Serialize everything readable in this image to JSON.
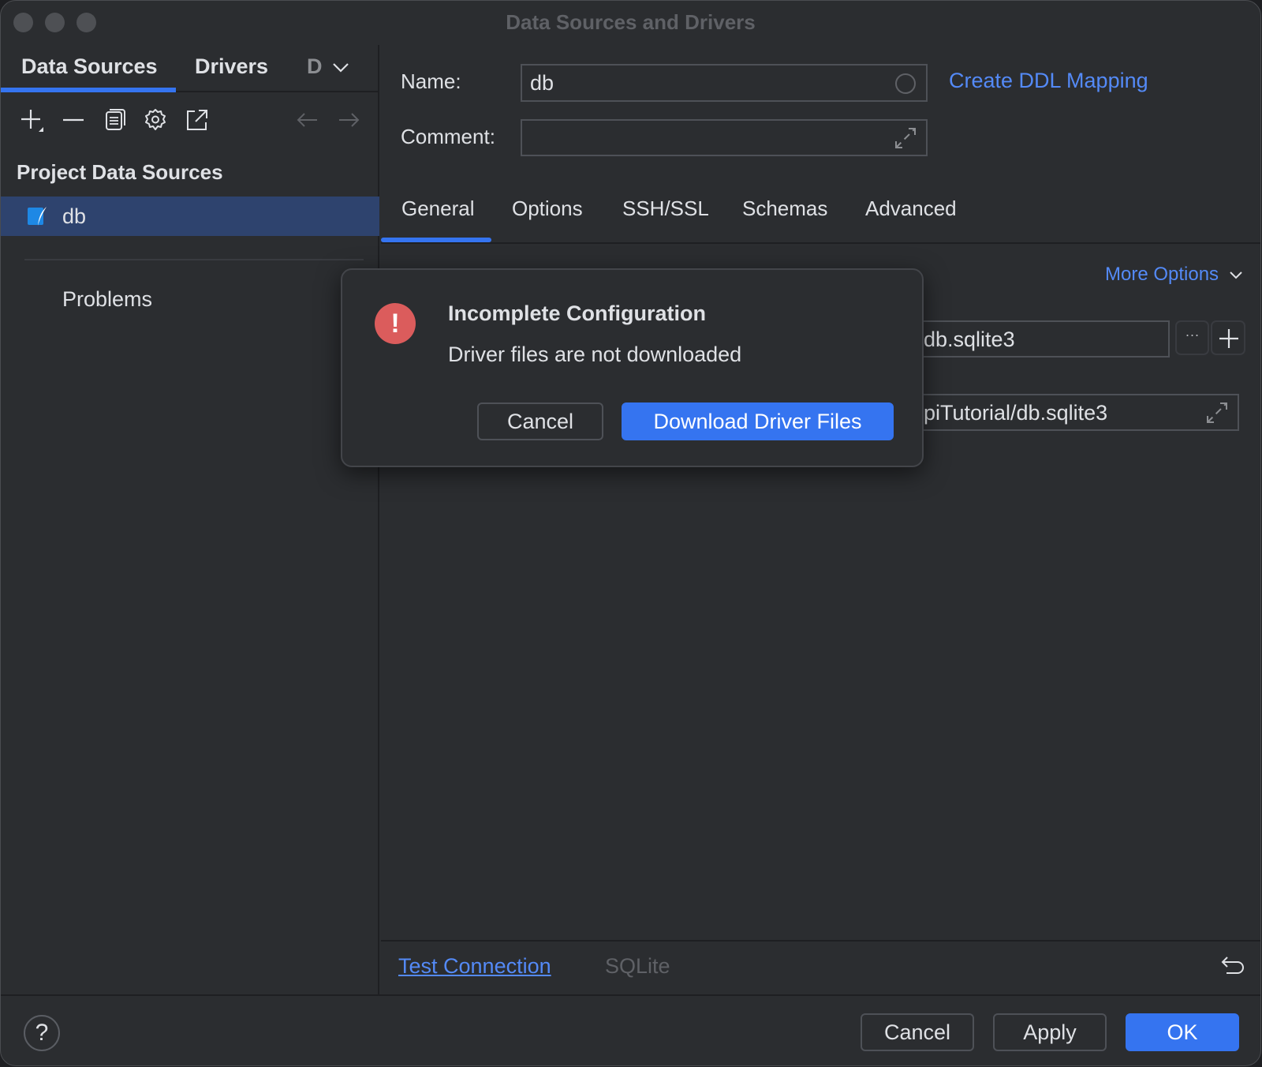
{
  "window": {
    "title": "Data Sources and Drivers"
  },
  "left_panel": {
    "tabs": [
      {
        "label": "Data Sources",
        "active": true
      },
      {
        "label": "Drivers",
        "active": false
      },
      {
        "label": "D",
        "active": false
      }
    ],
    "toolbar": {
      "icons": [
        "add-icon",
        "remove-icon",
        "duplicate-icon",
        "settings-icon",
        "export-icon",
        "back-arrow-icon",
        "forward-arrow-icon"
      ]
    },
    "section_title": "Project Data Sources",
    "data_sources": [
      {
        "label": "db",
        "icon": "sqlite-icon",
        "selected": true
      }
    ],
    "problems_label": "Problems"
  },
  "right_panel": {
    "name_label": "Name:",
    "name_value": "db",
    "comment_label": "Comment:",
    "comment_value": "",
    "ddl_link": "Create DDL Mapping",
    "tabs": [
      {
        "label": "General",
        "active": true
      },
      {
        "label": "Options",
        "active": false
      },
      {
        "label": "SSH/SSL",
        "active": false
      },
      {
        "label": "Schemas",
        "active": false
      },
      {
        "label": "Advanced",
        "active": false
      }
    ],
    "more_options": "More Options",
    "file_field_value": "db.sqlite3",
    "url_field_value": "piTutorial/db.sqlite3",
    "file_browse_label": "···",
    "test_connection": "Test Connection",
    "driver_name": "SQLite"
  },
  "modal": {
    "title": "Incomplete Configuration",
    "message": "Driver files are not downloaded",
    "cancel_label": "Cancel",
    "primary_label": "Download Driver Files",
    "icon_glyph": "!"
  },
  "footer": {
    "help_glyph": "?",
    "cancel_label": "Cancel",
    "apply_label": "Apply",
    "ok_label": "OK"
  },
  "colors": {
    "accent": "#3574f0",
    "link": "#548af7",
    "error": "#db5c5c",
    "selection": "#2e436e",
    "background": "#2b2d30"
  }
}
